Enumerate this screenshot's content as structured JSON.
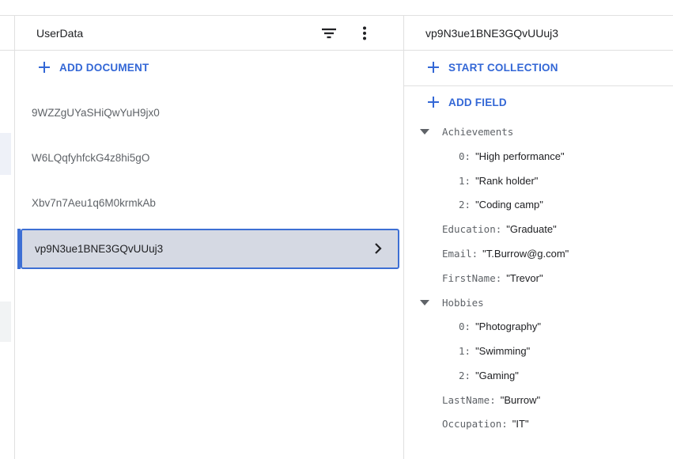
{
  "middle": {
    "title": "UserData",
    "add_document_label": "ADD DOCUMENT",
    "documents": [
      "9WZZgUYaSHiQwYuH9jx0",
      "W6LQqfyhfckG4z8hi5gO",
      "Xbv7n7Aeu1q6M0krmkAb"
    ],
    "selected_document": "vp9N3ue1BNE3GQvUUuj3"
  },
  "right": {
    "title": "vp9N3ue1BNE3GQvUUuj3",
    "start_collection_label": "START COLLECTION",
    "add_field_label": "ADD FIELD",
    "fields": {
      "achievements": {
        "key": "Achievements",
        "items": [
          {
            "index": "0",
            "value": "\"High performance\""
          },
          {
            "index": "1",
            "value": "\"Rank holder\""
          },
          {
            "index": "2",
            "value": "\"Coding camp\""
          }
        ]
      },
      "education": {
        "key": "Education",
        "value": "\"Graduate\""
      },
      "email": {
        "key": "Email",
        "value": "\"T.Burrow@g.com\""
      },
      "firstname": {
        "key": "FirstName",
        "value": "\"Trevor\""
      },
      "hobbies": {
        "key": "Hobbies",
        "items": [
          {
            "index": "0",
            "value": "\"Photography\""
          },
          {
            "index": "1",
            "value": "\"Swimming\""
          },
          {
            "index": "2",
            "value": "\"Gaming\""
          }
        ]
      },
      "lastname": {
        "key": "LastName",
        "value": "\"Burrow\""
      },
      "occupation": {
        "key": "Occupation",
        "value": "\"IT\""
      }
    }
  },
  "colors": {
    "accent": "#3367d6",
    "selected_bg": "#d5d9e3",
    "selected_border": "#3d6fd4",
    "divider": "#e0e0e0"
  },
  "icons": {
    "add": "plus-icon",
    "filter": "filter-icon",
    "more": "more-vert-icon",
    "chevron": "chevron-right-icon",
    "expand": "caret-down-icon"
  }
}
